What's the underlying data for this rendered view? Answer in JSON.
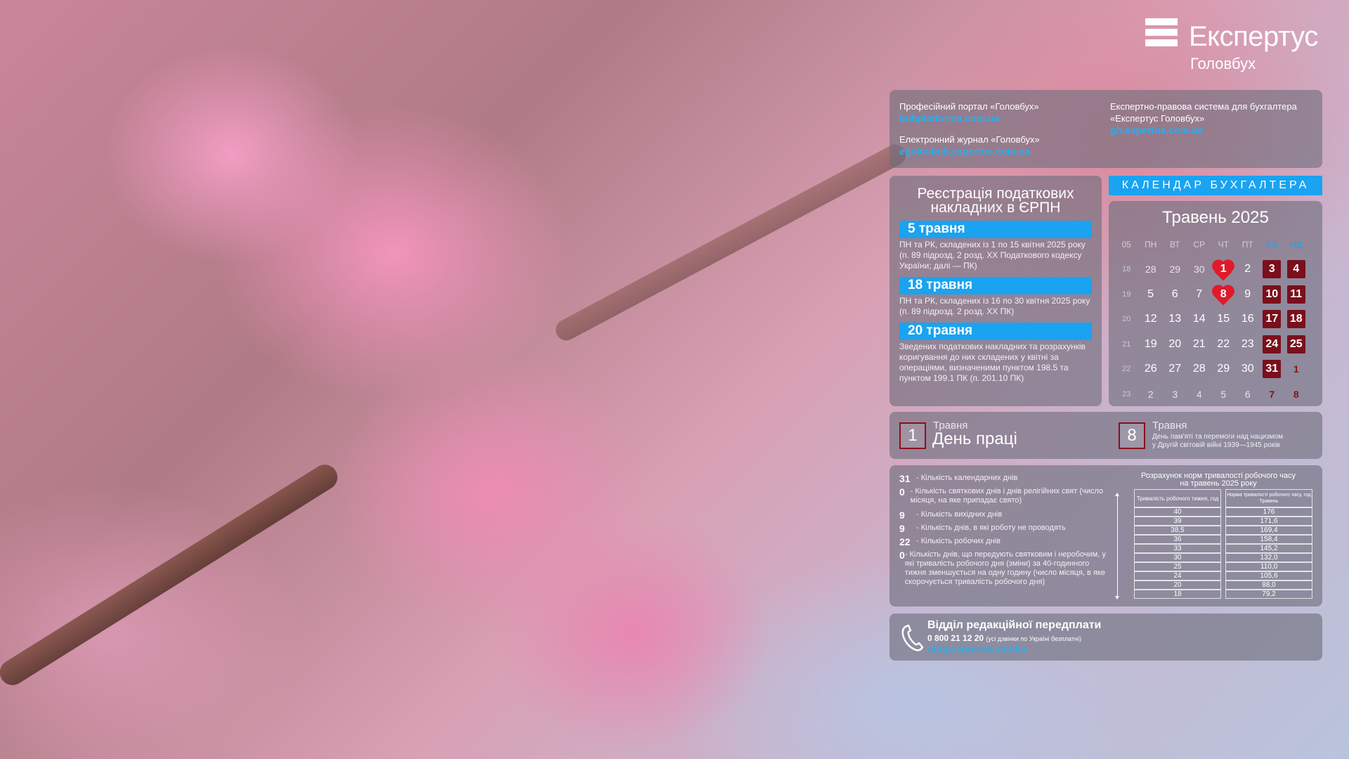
{
  "brand": {
    "title": "Експертус",
    "subtitle": "Головбух"
  },
  "links": {
    "portal_label": "Професійний портал «Головбух»",
    "portal_url": "buhplatforma.com.ua",
    "journal_label": "Електронний журнал «Головбух»",
    "journal_url": "egolovbuh.expertus.com.ua",
    "system_label_1": "Експертно-правова система для бухгалтера",
    "system_label_2": "«Експертус Головбух»",
    "system_url": "gb.expertus.com.ua"
  },
  "registration": {
    "title": "Реєстрація податкових накладних в ЄРПН",
    "items": [
      {
        "date": "5 травня",
        "text": "ПН та РК, складених із 1 по 15 квітня 2025 року (п. 89 підрозд. 2 розд. ХХ Податкового кодексу України; далі — ПК)"
      },
      {
        "date": "18 травня",
        "text": "ПН та РК, складених із 16 по 30 квітня 2025 року (п. 89 підрозд. 2 розд. ХХ ПК)"
      },
      {
        "date": "20 травня",
        "text": "Зведених податкових накладних та розрахунків коригування до них складених у квітні за операціями, визначеними пунктом 198.5 та пунктом 199.1 ПК (п. 201.10 ПК)"
      }
    ]
  },
  "calendar": {
    "banner": "КАЛЕНДАР БУХГАЛТЕРА",
    "month_title": "Травень 2025",
    "week_header": "05",
    "days": [
      "ПН",
      "ВТ",
      "СР",
      "ЧТ",
      "ПТ",
      "СБ",
      "НД"
    ],
    "weeks": [
      {
        "n": "18",
        "d": [
          "28",
          "29",
          "30",
          "1",
          "2",
          "3",
          "4"
        ]
      },
      {
        "n": "19",
        "d": [
          "5",
          "6",
          "7",
          "8",
          "9",
          "10",
          "11"
        ]
      },
      {
        "n": "20",
        "d": [
          "12",
          "13",
          "14",
          "15",
          "16",
          "17",
          "18"
        ]
      },
      {
        "n": "21",
        "d": [
          "19",
          "20",
          "21",
          "22",
          "23",
          "24",
          "25"
        ]
      },
      {
        "n": "22",
        "d": [
          "26",
          "27",
          "28",
          "29",
          "30",
          "31",
          "1"
        ]
      },
      {
        "n": "23",
        "d": [
          "2",
          "3",
          "4",
          "5",
          "6",
          "7",
          "8"
        ]
      }
    ]
  },
  "holidays": [
    {
      "day": "1",
      "month": "Травня",
      "name": "День праці"
    },
    {
      "day": "8",
      "month": "Травня",
      "name_1": "День пам'яті та перемоги над нацизмом",
      "name_2": "у Другій світовій війні 1939—1945 років"
    }
  ],
  "stats": [
    {
      "num": "31",
      "text": "- Кількість календарних днів"
    },
    {
      "num": "0",
      "text": "- Кількість святкових днів і днів релігійних свят (число місяця, на яке припадає свято)"
    },
    {
      "num": "9",
      "text": "- Кількість вихідних днів"
    },
    {
      "num": "9",
      "text": "- Кількість днів, в які роботу не проводять"
    },
    {
      "num": "22",
      "text": "- Кількість робочих днів"
    },
    {
      "num": "0",
      "text": "- Кількість днів, що передують святковим і неробочим, у які тривалість робочого дня (зміни) за 40-годинного тижня зменшується на одну годину (число місяця, в яке скорочується тривалість робочого дня)"
    }
  ],
  "norms": {
    "title_1": "Розрахунок норм тривалості робочого часу",
    "title_2": "на травень 2025 року",
    "col1": "Тривалість робочого тижня, год",
    "col2_1": "Норма тривалості робочого часу, год",
    "col2_2": "Травень",
    "rows": [
      [
        "40",
        "176"
      ],
      [
        "39",
        "171,6"
      ],
      [
        "38,5",
        "169,4"
      ],
      [
        "36",
        "158,4"
      ],
      [
        "33",
        "145,2"
      ],
      [
        "30",
        "132,0"
      ],
      [
        "25",
        "110,0"
      ],
      [
        "24",
        "105,6"
      ],
      [
        "20",
        "88,0"
      ],
      [
        "18",
        "79,2"
      ]
    ]
  },
  "subscription": {
    "title": "Відділ редакційної передплати",
    "phone": "0 800 21 12 20",
    "phone_note": "(усі дзвінки по Україні безплатні)",
    "url": "shop.expertus.media"
  },
  "colors": {
    "accent_blue": "#1aa3f0",
    "weekend_red": "#7b0f1c",
    "holiday_heart": "#e01a2a"
  }
}
